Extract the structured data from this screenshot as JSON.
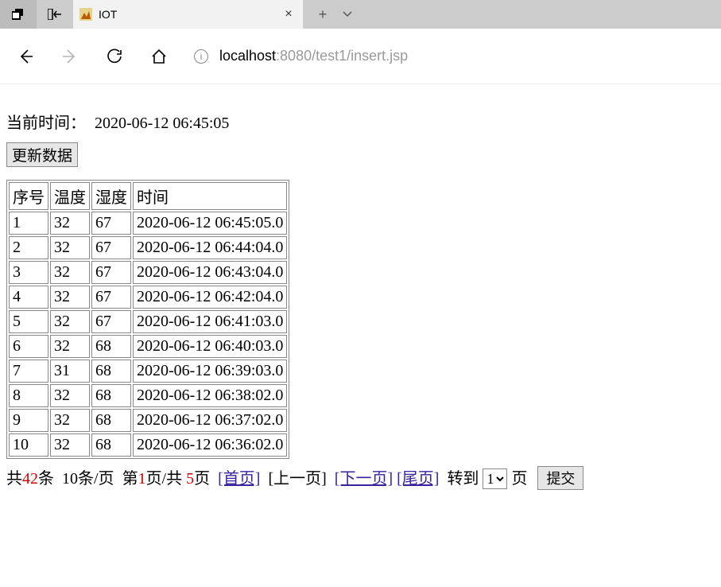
{
  "browser": {
    "tab_title": "IOT",
    "url_host": "localhost",
    "url_rest": ":8080/test1/insert.jsp"
  },
  "page": {
    "now_label": "当前时间：",
    "now_value": "2020-06-12 06:45:05",
    "update_btn": "更新数据"
  },
  "table": {
    "headers": [
      "序号",
      "温度",
      "湿度",
      "时间"
    ],
    "rows": [
      [
        "1",
        "32",
        "67",
        "2020-06-12 06:45:05.0"
      ],
      [
        "2",
        "32",
        "67",
        "2020-06-12 06:44:04.0"
      ],
      [
        "3",
        "32",
        "67",
        "2020-06-12 06:43:04.0"
      ],
      [
        "4",
        "32",
        "67",
        "2020-06-12 06:42:04.0"
      ],
      [
        "5",
        "32",
        "67",
        "2020-06-12 06:41:03.0"
      ],
      [
        "6",
        "32",
        "68",
        "2020-06-12 06:40:03.0"
      ],
      [
        "7",
        "31",
        "68",
        "2020-06-12 06:39:03.0"
      ],
      [
        "8",
        "32",
        "68",
        "2020-06-12 06:38:02.0"
      ],
      [
        "9",
        "32",
        "68",
        "2020-06-12 06:37:02.0"
      ],
      [
        "10",
        "32",
        "68",
        "2020-06-12 06:36:02.0"
      ]
    ]
  },
  "pager": {
    "t1": "共",
    "total": "42",
    "t2": "条",
    "t3": "10条/页",
    "t4": "第",
    "cur": "1",
    "t5": "页/共 ",
    "pages": "5",
    "t6": "页",
    "first": "[首页]",
    "prev": "[上一页]",
    "next": "[下一页]",
    "last": "[尾页]",
    "goto_l": "转到",
    "goto_v": "1",
    "goto_r": "页",
    "submit": "提交"
  }
}
